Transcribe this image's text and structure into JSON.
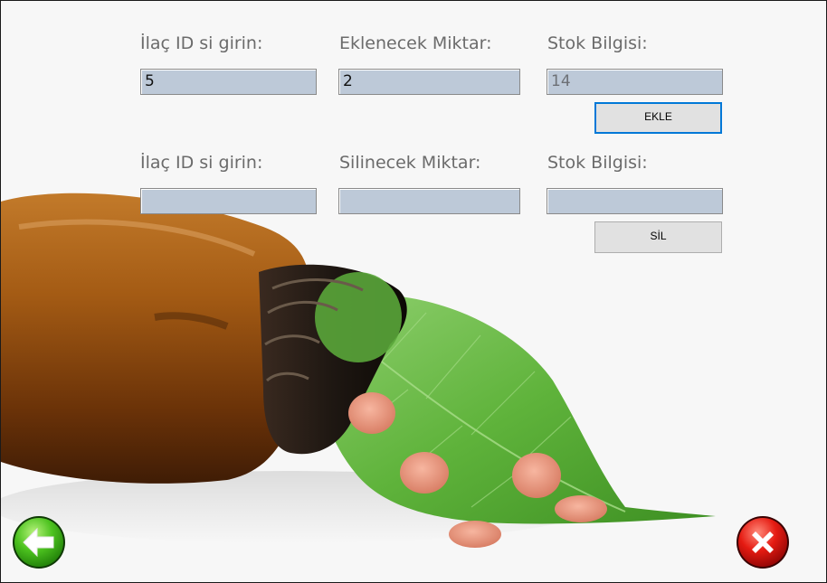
{
  "add_section": {
    "id_label": "İlaç ID si girin:",
    "amount_label": "Eklenecek Miktar:",
    "stock_label": "Stok Bilgisi:",
    "id_value": "5",
    "amount_value": "2",
    "stock_value": "14",
    "button_label": "EKLE"
  },
  "remove_section": {
    "id_label": "İlaç ID si girin:",
    "amount_label": "Silinecek Miktar:",
    "stock_label": "Stok Bilgisi:",
    "id_value": "",
    "amount_value": "",
    "stock_value": "",
    "button_label": "SİL"
  },
  "icons": {
    "back": "green-back-arrow-icon",
    "close": "red-close-x-icon"
  },
  "colors": {
    "input_bg": "#bdc9d8",
    "back_green": "#3cb319",
    "close_red": "#d91010",
    "focus_blue": "#0078d7"
  }
}
